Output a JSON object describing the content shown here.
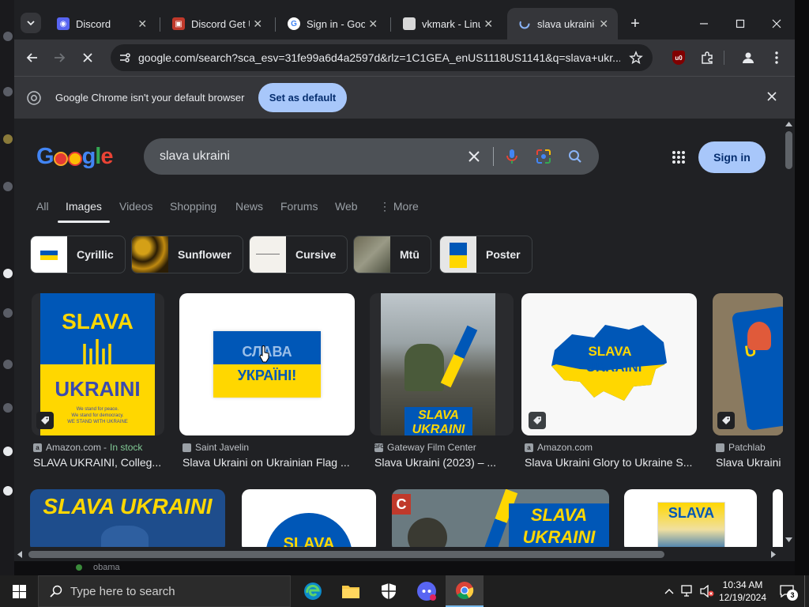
{
  "browser": {
    "tabs": [
      {
        "title": "Discord",
        "active": false
      },
      {
        "title": "Discord Get U",
        "active": false
      },
      {
        "title": "Sign in - Goog",
        "active": false
      },
      {
        "title": "vkmark - Linu",
        "active": false
      },
      {
        "title": "slava ukraini -",
        "active": true
      }
    ],
    "url": "google.com/search?sca_esv=31fe99a6d4a2597d&rlz=1C1GEA_enUS1118US1141&q=slava+ukr...",
    "infobar": {
      "message": "Google Chrome isn't your default browser",
      "button": "Set as default"
    }
  },
  "google": {
    "logo": "Google",
    "query": "slava ukraini",
    "sign_in": "Sign in",
    "filter_tabs": [
      "All",
      "Images",
      "Videos",
      "Shopping",
      "News",
      "Forums",
      "Web",
      "More"
    ],
    "selected_tab": "Images",
    "chips": [
      "Cyrillic",
      "Sunflower",
      "Cursive",
      "Mtū",
      "Poster"
    ],
    "results": [
      {
        "source": "Amazon.com",
        "badge": "In stock",
        "title": "SLAVA UKRAINI, Colleg..."
      },
      {
        "source": "Saint Javelin",
        "badge": "",
        "title": "Slava Ukraini on Ukrainian Flag ..."
      },
      {
        "source": "Gateway Film Center",
        "badge": "",
        "title": "Slava Ukraini (2023) – ..."
      },
      {
        "source": "Amazon.com",
        "badge": "",
        "title": "Slava Ukraini Glory to Ukraine S..."
      },
      {
        "source": "Patchlab",
        "badge": "",
        "title": "Slava Ukraini"
      }
    ],
    "image_text": {
      "poster_top": "SLAVA",
      "poster_bottom": "UKRAINI",
      "poster_small1": "We stand for peace.",
      "poster_small2": "We stand for democracy.",
      "poster_small3": "WE STAND WITH UKRAINE",
      "flag_top": "СЛАВА",
      "flag_bottom": "УКРАЇНІ!",
      "film_top": "SLAVA",
      "film_bottom": "UKRAINI",
      "map_top": "SLAVA",
      "map_bottom": "UKRAINI",
      "patch_letter": "U",
      "row2_banner": "SLAVA UKRAINI",
      "row2_circle": "SLAVA",
      "row2_flag_top": "SLAVA",
      "row2_flag_bottom": "UKRAINI",
      "row2_poster": "SLAVA"
    }
  },
  "below_window_text": "obama",
  "taskbar": {
    "search_placeholder": "Type here to search",
    "time": "10:34 AM",
    "date": "12/19/2024",
    "notifications": "3"
  },
  "colors": {
    "ukraine_blue": "#0057b7",
    "ukraine_yellow": "#ffd700",
    "accent": "#a8c7fa"
  }
}
